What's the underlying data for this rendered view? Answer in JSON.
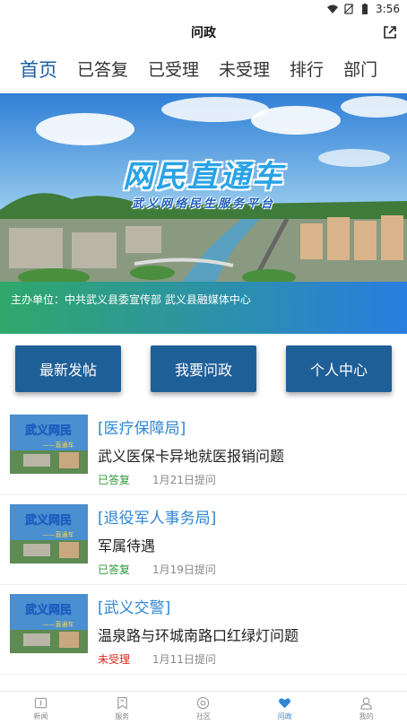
{
  "status_bar": {
    "time": "3:56"
  },
  "header": {
    "title": "问政"
  },
  "tabs": [
    {
      "label": "首页",
      "active": true
    },
    {
      "label": "已答复",
      "active": false
    },
    {
      "label": "已受理",
      "active": false
    },
    {
      "label": "未受理",
      "active": false
    },
    {
      "label": "排行",
      "active": false
    },
    {
      "label": "部门",
      "active": false
    }
  ],
  "banner": {
    "title": "网民直通车",
    "subtitle": "武义网络民生服务平台",
    "sponsor": "主办单位：中共武义县委宣传部 武义县融媒体中心"
  },
  "actions": {
    "latest_post": "最新发帖",
    "ask_gov": "我要问政",
    "personal_center": "个人中心"
  },
  "thumb_text": {
    "line1": "武义网民",
    "line2": "——直通车"
  },
  "posts": [
    {
      "dept": "[医疗保障局]",
      "title": "武义医保卡异地就医报销问题",
      "status": "已答复",
      "status_color": "#2e9a3a",
      "date": "1月21日提问"
    },
    {
      "dept": "[退役军人事务局]",
      "title": "军属待遇",
      "status": "已答复",
      "status_color": "#2e9a3a",
      "date": "1月19日提问"
    },
    {
      "dept": "[武义交警]",
      "title": "温泉路与环城南路口红绿灯问题",
      "status": "未受理",
      "status_color": "#d9261c",
      "date": "1月11日提问"
    }
  ],
  "bottom_nav": [
    {
      "label": "新闻",
      "icon": "news-icon",
      "active": false
    },
    {
      "label": "服务",
      "icon": "bookmark-icon",
      "active": false
    },
    {
      "label": "社区",
      "icon": "community-icon",
      "active": false
    },
    {
      "label": "问政",
      "icon": "heart-icon",
      "active": true
    },
    {
      "label": "我的",
      "icon": "user-icon",
      "active": false
    }
  ],
  "colors": {
    "accent": "#1a5fa8",
    "button": "#1f5f98",
    "dept_text": "#2e86d4",
    "answered": "#2e9a3a",
    "unaccepted": "#d9261c"
  }
}
